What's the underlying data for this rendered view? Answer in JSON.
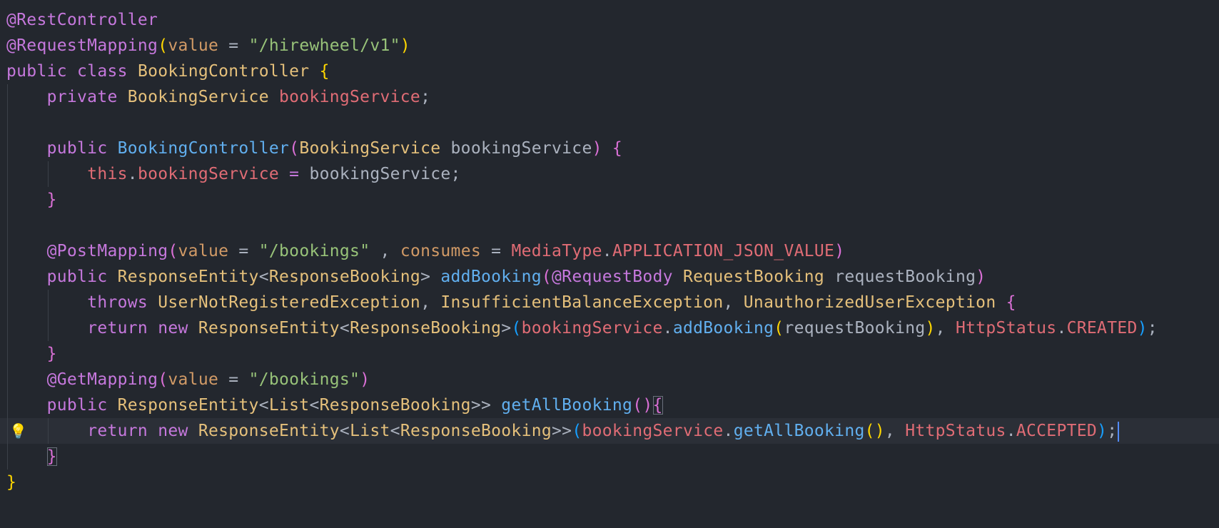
{
  "editor": {
    "theme": {
      "background": "#23272e",
      "current_line": "#2b2f37",
      "cursor": "#528bff",
      "keyword": "#c678dd",
      "type": "#e5c07b",
      "field": "#e06c75",
      "function": "#61afef",
      "string": "#98c379",
      "attribute": "#d19a66",
      "bracket_level1": "#ffd700",
      "bracket_level2": "#da70d6",
      "bracket_level3": "#179fff"
    },
    "gutter_icon": "lightbulb-icon",
    "lines": [
      [
        {
          "t": "@RestController",
          "c": "ann"
        }
      ],
      [
        {
          "t": "@RequestMapping",
          "c": "ann"
        },
        {
          "t": "(",
          "c": "br1"
        },
        {
          "t": "value",
          "c": "attr"
        },
        {
          "t": " = ",
          "c": "pun"
        },
        {
          "t": "\"/hirewheel/v1\"",
          "c": "str"
        },
        {
          "t": ")",
          "c": "br1"
        }
      ],
      [
        {
          "t": "public",
          "c": "kw"
        },
        {
          "t": " ",
          "c": "pun"
        },
        {
          "t": "class",
          "c": "kw"
        },
        {
          "t": " ",
          "c": "pun"
        },
        {
          "t": "BookingController",
          "c": "type"
        },
        {
          "t": " ",
          "c": "pun"
        },
        {
          "t": "{",
          "c": "br1"
        }
      ],
      [
        {
          "t": "    ",
          "c": "pun"
        },
        {
          "t": "private",
          "c": "kw"
        },
        {
          "t": " ",
          "c": "pun"
        },
        {
          "t": "BookingService",
          "c": "type"
        },
        {
          "t": " ",
          "c": "pun"
        },
        {
          "t": "bookingService",
          "c": "fld"
        },
        {
          "t": ";",
          "c": "pun"
        }
      ],
      [],
      [
        {
          "t": "    ",
          "c": "pun"
        },
        {
          "t": "public",
          "c": "kw"
        },
        {
          "t": " ",
          "c": "pun"
        },
        {
          "t": "BookingController",
          "c": "fn"
        },
        {
          "t": "(",
          "c": "br2"
        },
        {
          "t": "BookingService",
          "c": "type"
        },
        {
          "t": " ",
          "c": "pun"
        },
        {
          "t": "bookingService",
          "c": "var"
        },
        {
          "t": ")",
          "c": "br2"
        },
        {
          "t": " ",
          "c": "pun"
        },
        {
          "t": "{",
          "c": "br2"
        }
      ],
      [
        {
          "t": "        ",
          "c": "pun"
        },
        {
          "t": "this",
          "c": "fld"
        },
        {
          "t": ".",
          "c": "pun"
        },
        {
          "t": "bookingService",
          "c": "fld"
        },
        {
          "t": " ",
          "c": "pun"
        },
        {
          "t": "=",
          "c": "kw"
        },
        {
          "t": " ",
          "c": "pun"
        },
        {
          "t": "bookingService",
          "c": "var"
        },
        {
          "t": ";",
          "c": "pun"
        }
      ],
      [
        {
          "t": "    ",
          "c": "pun"
        },
        {
          "t": "}",
          "c": "br2"
        }
      ],
      [],
      [
        {
          "t": "    ",
          "c": "pun"
        },
        {
          "t": "@PostMapping",
          "c": "ann"
        },
        {
          "t": "(",
          "c": "br2"
        },
        {
          "t": "value",
          "c": "attr"
        },
        {
          "t": " = ",
          "c": "pun"
        },
        {
          "t": "\"/bookings\"",
          "c": "str"
        },
        {
          "t": " , ",
          "c": "pun"
        },
        {
          "t": "consumes",
          "c": "attr"
        },
        {
          "t": " = ",
          "c": "pun"
        },
        {
          "t": "MediaType",
          "c": "fld"
        },
        {
          "t": ".",
          "c": "pun"
        },
        {
          "t": "APPLICATION_JSON_VALUE",
          "c": "fld"
        },
        {
          "t": ")",
          "c": "br2"
        }
      ],
      [
        {
          "t": "    ",
          "c": "pun"
        },
        {
          "t": "public",
          "c": "kw"
        },
        {
          "t": " ",
          "c": "pun"
        },
        {
          "t": "ResponseEntity",
          "c": "type"
        },
        {
          "t": "<",
          "c": "pun"
        },
        {
          "t": "ResponseBooking",
          "c": "type"
        },
        {
          "t": ">",
          "c": "pun"
        },
        {
          "t": " ",
          "c": "pun"
        },
        {
          "t": "addBooking",
          "c": "fn"
        },
        {
          "t": "(",
          "c": "br2"
        },
        {
          "t": "@RequestBody",
          "c": "ann"
        },
        {
          "t": " ",
          "c": "pun"
        },
        {
          "t": "RequestBooking",
          "c": "type"
        },
        {
          "t": " ",
          "c": "pun"
        },
        {
          "t": "requestBooking",
          "c": "var"
        },
        {
          "t": ")",
          "c": "br2"
        }
      ],
      [
        {
          "t": "        ",
          "c": "pun"
        },
        {
          "t": "throws",
          "c": "kw"
        },
        {
          "t": " ",
          "c": "pun"
        },
        {
          "t": "UserNotRegisteredException",
          "c": "type"
        },
        {
          "t": ", ",
          "c": "pun"
        },
        {
          "t": "InsufficientBalanceException",
          "c": "type"
        },
        {
          "t": ", ",
          "c": "pun"
        },
        {
          "t": "UnauthorizedUserException",
          "c": "type"
        },
        {
          "t": " ",
          "c": "pun"
        },
        {
          "t": "{",
          "c": "br2"
        }
      ],
      [
        {
          "t": "        ",
          "c": "pun"
        },
        {
          "t": "return",
          "c": "kw"
        },
        {
          "t": " ",
          "c": "pun"
        },
        {
          "t": "new",
          "c": "kw"
        },
        {
          "t": " ",
          "c": "pun"
        },
        {
          "t": "ResponseEntity",
          "c": "type"
        },
        {
          "t": "<",
          "c": "pun"
        },
        {
          "t": "ResponseBooking",
          "c": "type"
        },
        {
          "t": ">",
          "c": "pun"
        },
        {
          "t": "(",
          "c": "br3"
        },
        {
          "t": "bookingService",
          "c": "fld"
        },
        {
          "t": ".",
          "c": "pun"
        },
        {
          "t": "addBooking",
          "c": "fn"
        },
        {
          "t": "(",
          "c": "br1"
        },
        {
          "t": "requestBooking",
          "c": "var"
        },
        {
          "t": ")",
          "c": "br1"
        },
        {
          "t": ", ",
          "c": "pun"
        },
        {
          "t": "HttpStatus",
          "c": "fld"
        },
        {
          "t": ".",
          "c": "pun"
        },
        {
          "t": "CREATED",
          "c": "fld"
        },
        {
          "t": ")",
          "c": "br3"
        },
        {
          "t": ";",
          "c": "pun"
        }
      ],
      [
        {
          "t": "    ",
          "c": "pun"
        },
        {
          "t": "}",
          "c": "br2"
        }
      ],
      [
        {
          "t": "    ",
          "c": "pun"
        },
        {
          "t": "@GetMapping",
          "c": "ann"
        },
        {
          "t": "(",
          "c": "br2"
        },
        {
          "t": "value",
          "c": "attr"
        },
        {
          "t": " = ",
          "c": "pun"
        },
        {
          "t": "\"/bookings\"",
          "c": "str"
        },
        {
          "t": ")",
          "c": "br2"
        }
      ],
      [
        {
          "t": "    ",
          "c": "pun"
        },
        {
          "t": "public",
          "c": "kw"
        },
        {
          "t": " ",
          "c": "pun"
        },
        {
          "t": "ResponseEntity",
          "c": "type"
        },
        {
          "t": "<",
          "c": "pun"
        },
        {
          "t": "List",
          "c": "type"
        },
        {
          "t": "<",
          "c": "pun"
        },
        {
          "t": "ResponseBooking",
          "c": "type"
        },
        {
          "t": ">>",
          "c": "pun"
        },
        {
          "t": " ",
          "c": "pun"
        },
        {
          "t": "getAllBooking",
          "c": "fn"
        },
        {
          "t": "()",
          "c": "br2"
        },
        {
          "t": "{",
          "c": "br2",
          "match": true
        }
      ],
      [
        {
          "t": "        ",
          "c": "pun"
        },
        {
          "t": "return",
          "c": "kw"
        },
        {
          "t": " ",
          "c": "pun"
        },
        {
          "t": "new",
          "c": "kw"
        },
        {
          "t": " ",
          "c": "pun"
        },
        {
          "t": "ResponseEntity",
          "c": "type"
        },
        {
          "t": "<",
          "c": "pun"
        },
        {
          "t": "List",
          "c": "type"
        },
        {
          "t": "<",
          "c": "pun"
        },
        {
          "t": "ResponseBooking",
          "c": "type"
        },
        {
          "t": ">>",
          "c": "pun"
        },
        {
          "t": "(",
          "c": "br3"
        },
        {
          "t": "bookingService",
          "c": "fld"
        },
        {
          "t": ".",
          "c": "pun"
        },
        {
          "t": "getAllBooking",
          "c": "fn"
        },
        {
          "t": "()",
          "c": "br1"
        },
        {
          "t": ", ",
          "c": "pun"
        },
        {
          "t": "HttpStatus",
          "c": "fld"
        },
        {
          "t": ".",
          "c": "pun"
        },
        {
          "t": "ACCEPTED",
          "c": "fld"
        },
        {
          "t": ")",
          "c": "br3"
        },
        {
          "t": ";",
          "c": "pun"
        }
      ],
      [
        {
          "t": "    ",
          "c": "pun"
        },
        {
          "t": "}",
          "c": "br2",
          "match": true
        }
      ],
      [
        {
          "t": "}",
          "c": "br1"
        }
      ]
    ]
  }
}
